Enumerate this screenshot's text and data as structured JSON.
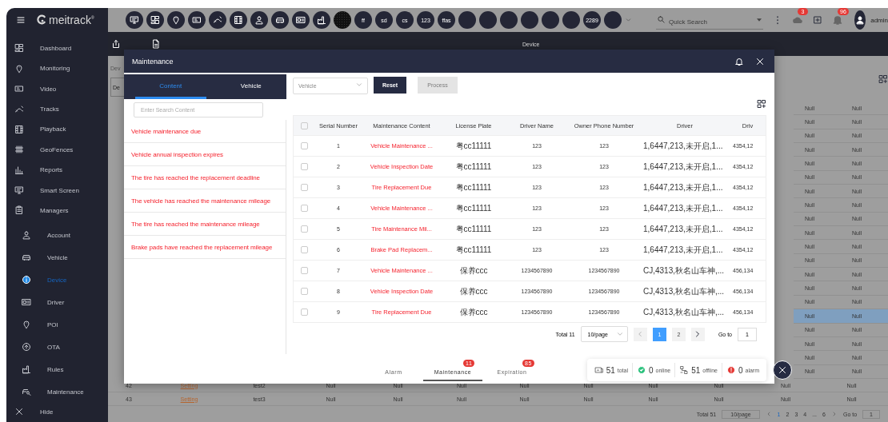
{
  "sidebar": {
    "logo": "meitrack$^{®}$",
    "items": [
      {
        "label": "Dashboard",
        "selected": false
      },
      {
        "label": "Monitoring",
        "selected": false
      },
      {
        "label": "Video",
        "selected": false
      },
      {
        "label": "Tracks",
        "selected": false
      },
      {
        "label": "Playback",
        "selected": false
      },
      {
        "label": "GeoFences",
        "selected": false
      },
      {
        "label": "Reports",
        "selected": false
      },
      {
        "label": "Smart Screen",
        "selected": false
      },
      {
        "label": "Managers",
        "selected": false,
        "expanded": true,
        "children": [
          {
            "label": "Account",
            "selected": false
          },
          {
            "label": "Vehicle",
            "selected": false
          },
          {
            "label": "Device",
            "selected": true
          },
          {
            "label": "Driver",
            "selected": false
          },
          {
            "label": "POI",
            "selected": false
          },
          {
            "label": "OTA",
            "selected": false
          },
          {
            "label": "Rules",
            "selected": false
          },
          {
            "label": "Maintenance",
            "selected": false
          }
        ]
      }
    ],
    "hide": "Hide"
  },
  "topbar": {
    "quick_items": [
      {
        "kind": "icon"
      },
      {
        "kind": "icon"
      },
      {
        "kind": "icon"
      },
      {
        "kind": "icon"
      },
      {
        "kind": "icon"
      },
      {
        "kind": "icon"
      },
      {
        "kind": "icon"
      },
      {
        "kind": "icon"
      },
      {
        "kind": "icon"
      },
      {
        "kind": "icon"
      },
      {
        "kind": "image"
      },
      {
        "kind": "text",
        "text": "ff"
      },
      {
        "kind": "text",
        "text": "sd"
      },
      {
        "kind": "text",
        "text": "cs"
      },
      {
        "kind": "text",
        "text": "123"
      },
      {
        "kind": "text",
        "text": "ffas"
      },
      {
        "kind": "blank"
      },
      {
        "kind": "blank"
      },
      {
        "kind": "blank"
      },
      {
        "kind": "blank"
      },
      {
        "kind": "blank"
      },
      {
        "kind": "blank"
      },
      {
        "kind": "text",
        "text": "2289"
      },
      {
        "kind": "blank"
      }
    ],
    "search": {
      "placeholder": "Quick Search"
    },
    "cloud_badge": "3",
    "bell_badge": "96",
    "user": "admin"
  },
  "subbar": {
    "title": "Device"
  },
  "background": {
    "tab": "Dev",
    "field_value": "De",
    "side_rows": [
      {
        "cells": [
          "Null",
          "Null"
        ],
        "selected": false
      },
      {
        "cells": [
          "Null",
          "Null"
        ],
        "selected": false
      },
      {
        "cells": [
          "Null",
          "Null"
        ],
        "selected": false
      },
      {
        "cells": [
          "Null",
          "Null"
        ],
        "selected": false
      },
      {
        "cells": [
          "Null",
          "Null"
        ],
        "selected": false
      },
      {
        "cells": [
          "Null",
          "Null"
        ],
        "selected": false
      },
      {
        "cells": [
          "Null",
          "Null"
        ],
        "selected": false
      },
      {
        "cells": [
          "Null",
          "Null"
        ],
        "selected": false
      },
      {
        "cells": [
          "Null",
          "Null"
        ],
        "selected": false
      },
      {
        "cells": [
          "Null",
          "Null"
        ],
        "selected": false
      },
      {
        "cells": [
          "Null",
          "Null"
        ],
        "selected": false
      },
      {
        "cells": [
          "Null",
          "Null"
        ],
        "selected": false
      },
      {
        "cells": [
          "Null",
          "Null"
        ],
        "selected": false
      },
      {
        "cells": [
          "Null",
          "Null"
        ],
        "selected": false
      },
      {
        "cells": [
          "Null",
          "Null"
        ],
        "selected": false
      },
      {
        "cells": [
          "Null",
          "Null"
        ],
        "selected": true
      },
      {
        "cells": [
          "Null",
          "Null"
        ],
        "selected": false
      },
      {
        "cells": [
          "Null",
          "Null"
        ],
        "selected": false
      },
      {
        "cells": [
          "Null",
          "Null"
        ],
        "selected": false
      },
      {
        "cells": [
          "Null",
          "Null"
        ],
        "selected": false
      }
    ],
    "rows": [
      {
        "cells": [
          "42",
          "Setting",
          "test2",
          "Null",
          "Null",
          "Null",
          "Null",
          "Null",
          "Null",
          "Null",
          "Null",
          "Null"
        ]
      },
      {
        "cells": [
          "43",
          "Setting",
          "test3",
          "Null",
          "Null",
          "Null",
          "Null",
          "Null",
          "Null",
          "Null",
          "Null",
          "Null"
        ]
      }
    ],
    "pagination": {
      "total": "Total 51",
      "page_size": "10/page",
      "pages": [
        {
          "label": "1",
          "selected": true
        },
        {
          "label": "2",
          "selected": false
        },
        {
          "label": "3",
          "selected": false
        },
        {
          "label": "4",
          "selected": false
        },
        {
          "label": "...",
          "selected": false
        },
        {
          "label": "6",
          "selected": false
        }
      ],
      "goto_label": "Go to",
      "goto_value": "1"
    }
  },
  "modal": {
    "title": "Maintenance",
    "tabs": [
      {
        "label": "Content",
        "selected": true
      },
      {
        "label": "Vehicle",
        "selected": false
      }
    ],
    "search": {
      "placeholder": "Enter Search Content"
    },
    "contents": [
      "Vehicle maintenance due",
      "Vehicle annual inspection expires",
      "The tire has reached the replacement deadline",
      "The vehicle has reached the maintenance mileage",
      "The tire has reached the maintenance mileage",
      "Brake pads have reached the replacement mileage"
    ],
    "vehicle_select": {
      "placeholder": "Vehicle"
    },
    "reset": {
      "label": "Reset"
    },
    "process": {
      "label": "Process",
      "disabled": true
    },
    "table": {
      "header_checked": false,
      "columns": [
        "Serial Number",
        "Maintenance Content",
        "License Plate",
        "Driver Name",
        "Owner Phone Number",
        "Driver",
        "Driv"
      ],
      "rows": [
        {
          "checked": false,
          "cells": [
            "1",
            "Vehicle Maintenance ...",
            "粤cc11111",
            "123",
            "123",
            "1,6447,213,未开启,1...",
            "4354,12"
          ]
        },
        {
          "checked": false,
          "cells": [
            "2",
            "Vehicle Inspection Date",
            "粤cc11111",
            "123",
            "123",
            "1,6447,213,未开启,1...",
            "4354,12"
          ]
        },
        {
          "checked": false,
          "cells": [
            "3",
            "Tire Replacement Due",
            "粤cc11111",
            "123",
            "123",
            "1,6447,213,未开启,1...",
            "4354,12"
          ]
        },
        {
          "checked": false,
          "cells": [
            "4",
            "Vehicle Maintenance ...",
            "粤cc11111",
            "123",
            "123",
            "1,6447,213,未开启,1...",
            "4354,12"
          ]
        },
        {
          "checked": false,
          "cells": [
            "5",
            "Tire Maintenance Mil...",
            "粤cc11111",
            "123",
            "123",
            "1,6447,213,未开启,1...",
            "4354,12"
          ]
        },
        {
          "checked": false,
          "cells": [
            "6",
            "Brake Pad Replacem...",
            "粤cc11111",
            "123",
            "123",
            "1,6447,213,未开启,1...",
            "4354,12"
          ]
        },
        {
          "checked": false,
          "cells": [
            "7",
            "Vehicle Maintenance ...",
            "保养ccc",
            "1234567890",
            "1234567890",
            "CJ,4313,秋名山车神,...",
            "456,134"
          ]
        },
        {
          "checked": false,
          "cells": [
            "8",
            "Vehicle Inspection Date",
            "保养ccc",
            "1234567890",
            "1234567890",
            "CJ,4313,秋名山车神,...",
            "456,134"
          ]
        },
        {
          "checked": false,
          "cells": [
            "9",
            "Tire Replacement Due",
            "保养ccc",
            "1234567890",
            "1234567890",
            "CJ,4313,秋名山车神,...",
            "456,134"
          ]
        }
      ]
    },
    "pagination": {
      "total": "Total 11",
      "page_size": "10/page",
      "pages": [
        {
          "label": "1",
          "selected": true
        },
        {
          "label": "2",
          "selected": false
        }
      ],
      "goto_label": "Go to",
      "goto_value": "1"
    },
    "bottom_tabs": [
      {
        "label": "Alarm",
        "selected": false
      },
      {
        "label": "Maintenance",
        "badge": "11",
        "selected": true
      },
      {
        "label": "Expiration",
        "badge": "85",
        "selected": false
      }
    ],
    "stats": [
      {
        "kind": "total",
        "value": "51",
        "label": "total"
      },
      {
        "kind": "online",
        "value": "0",
        "label": "online"
      },
      {
        "kind": "offline",
        "value": "51",
        "label": "offline"
      },
      {
        "kind": "alarm",
        "value": "0",
        "label": "alarm"
      }
    ]
  }
}
